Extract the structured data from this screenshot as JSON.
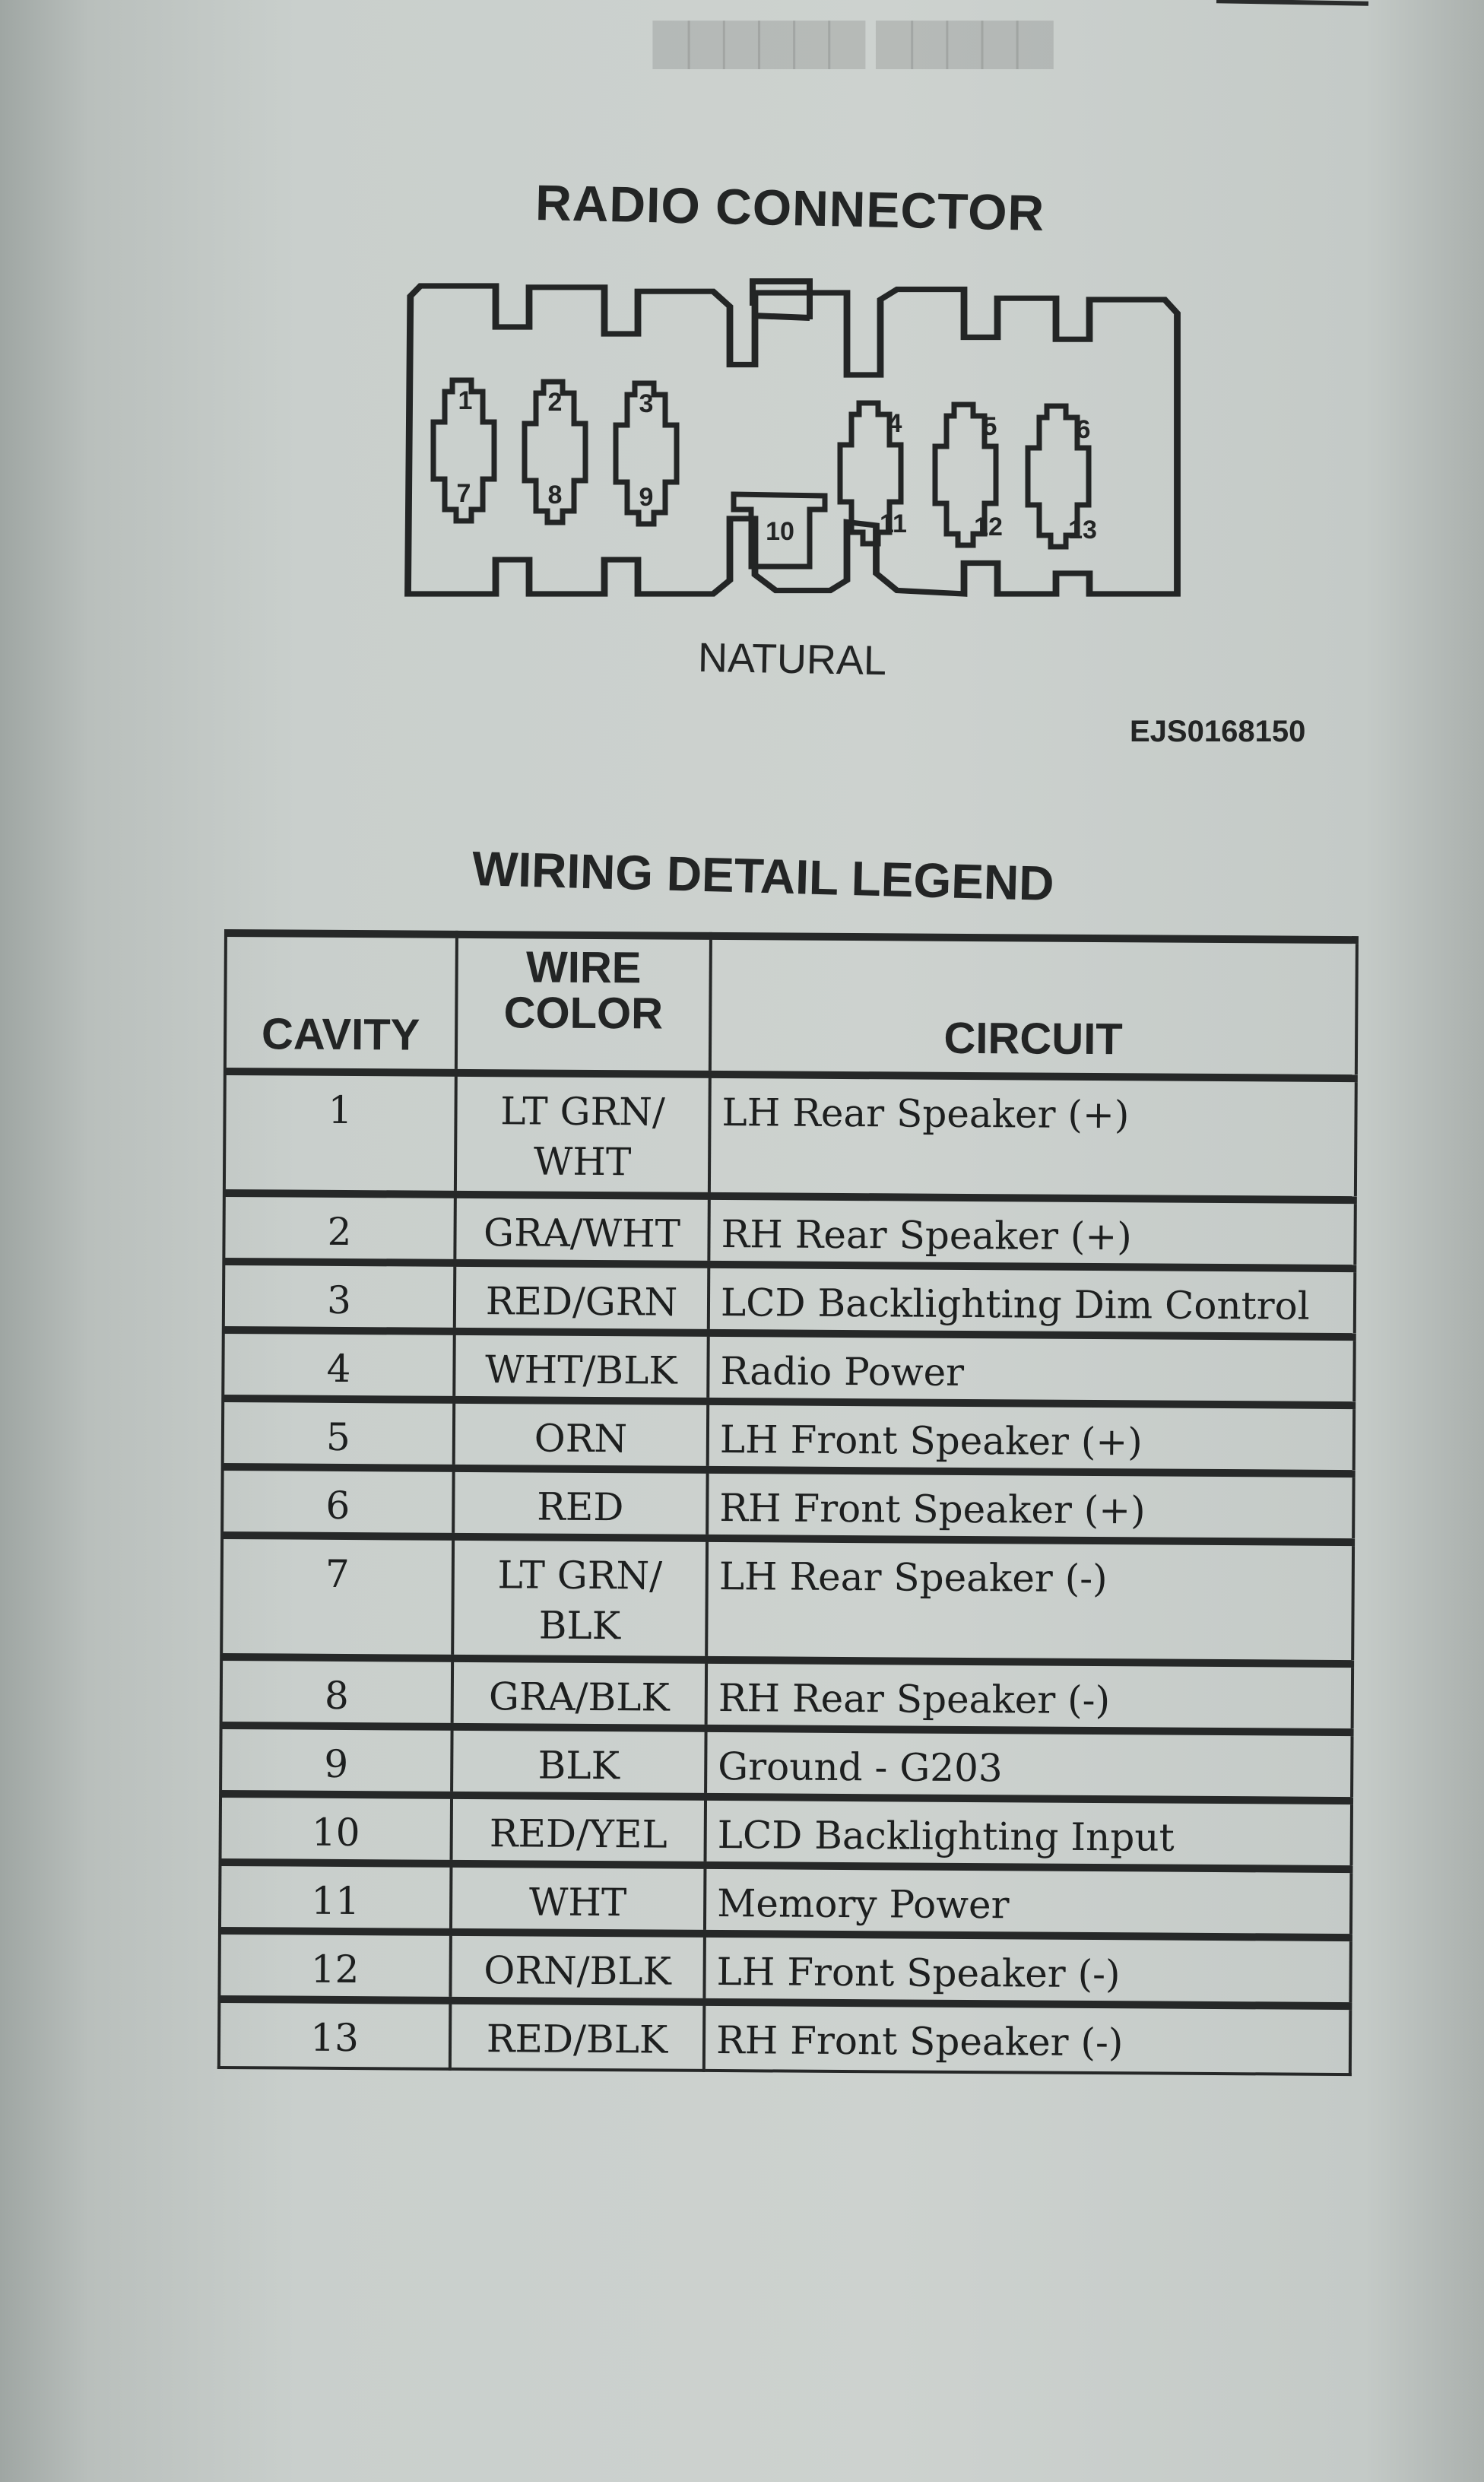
{
  "diagram": {
    "title": "RADIO CONNECTOR",
    "connector_color_label": "NATURAL",
    "figure_id": "EJS0168150",
    "cavity_labels": [
      "1",
      "2",
      "3",
      "4",
      "5",
      "6",
      "7",
      "8",
      "9",
      "10",
      "11",
      "12",
      "13"
    ]
  },
  "legend": {
    "title": "WIRING DETAIL LEGEND",
    "headers": {
      "cavity": "CAVITY",
      "wire_color": "WIRE\nCOLOR",
      "circuit": "CIRCUIT"
    },
    "rows": [
      {
        "cavity": "1",
        "wire_color": "LT GRN/\nWHT",
        "circuit": "LH Rear Speaker (+)"
      },
      {
        "cavity": "2",
        "wire_color": "GRA/WHT",
        "circuit": "RH Rear Speaker (+)"
      },
      {
        "cavity": "3",
        "wire_color": "RED/GRN",
        "circuit": "LCD Backlighting Dim Control"
      },
      {
        "cavity": "4",
        "wire_color": "WHT/BLK",
        "circuit": "Radio Power"
      },
      {
        "cavity": "5",
        "wire_color": "ORN",
        "circuit": "LH Front Speaker (+)"
      },
      {
        "cavity": "6",
        "wire_color": "RED",
        "circuit": "RH Front Speaker (+)"
      },
      {
        "cavity": "7",
        "wire_color": "LT GRN/\nBLK",
        "circuit": "LH Rear Speaker (-)"
      },
      {
        "cavity": "8",
        "wire_color": "GRA/BLK",
        "circuit": "RH Rear Speaker (-)"
      },
      {
        "cavity": "9",
        "wire_color": "BLK",
        "circuit": "Ground - G203"
      },
      {
        "cavity": "10",
        "wire_color": "RED/YEL",
        "circuit": "LCD Backlighting Input"
      },
      {
        "cavity": "11",
        "wire_color": "WHT",
        "circuit": "Memory Power"
      },
      {
        "cavity": "12",
        "wire_color": "ORN/BLK",
        "circuit": "LH Front Speaker (-)"
      },
      {
        "cavity": "13",
        "wire_color": "RED/BLK",
        "circuit": "RH Front Speaker (-)"
      }
    ]
  }
}
